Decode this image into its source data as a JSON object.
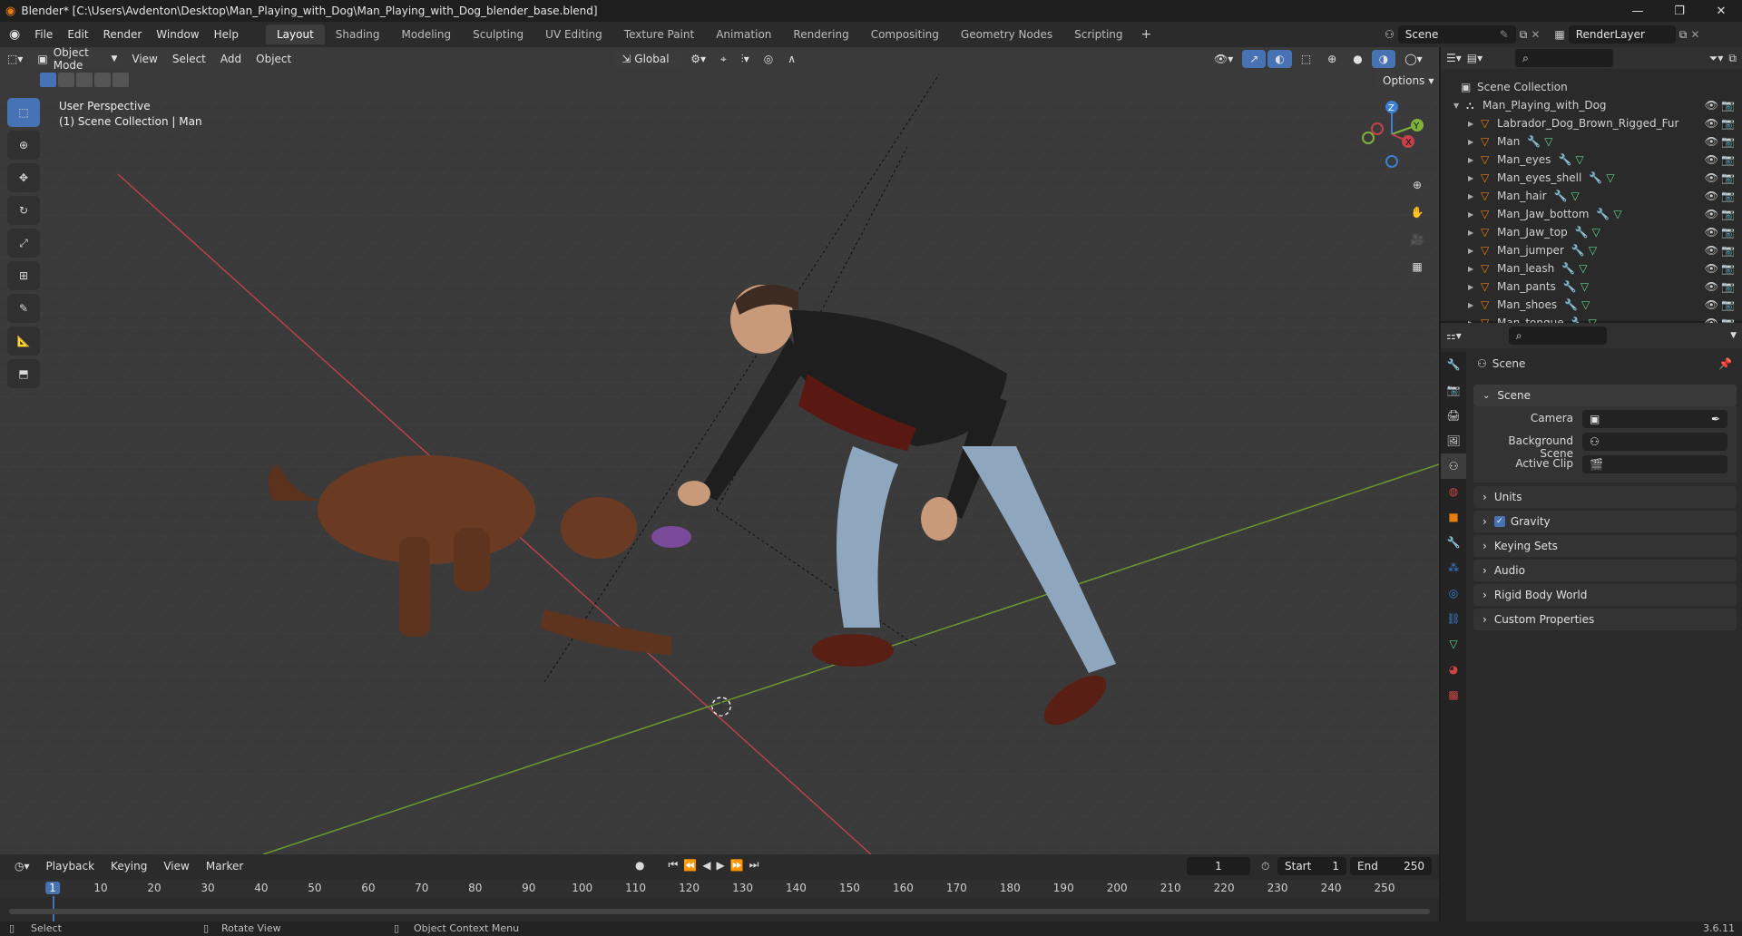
{
  "titlebar": {
    "title": "Blender* [C:\\Users\\Avdenton\\Desktop\\Man_Playing_with_Dog\\Man_Playing_with_Dog_blender_base.blend]"
  },
  "menus": [
    "File",
    "Edit",
    "Render",
    "Window",
    "Help"
  ],
  "workspaces": [
    "Layout",
    "Shading",
    "Modeling",
    "Sculpting",
    "UV Editing",
    "Texture Paint",
    "Animation",
    "Rendering",
    "Compositing",
    "Geometry Nodes",
    "Scripting"
  ],
  "active_workspace": "Layout",
  "scene_field": "Scene",
  "renderlayer_field": "RenderLayer",
  "viewport": {
    "mode": "Object Mode",
    "menus": [
      "View",
      "Select",
      "Add",
      "Object"
    ],
    "transform": "Global",
    "options": "Options",
    "overlay_line1": "User Perspective",
    "overlay_line2": "(1) Scene Collection | Man"
  },
  "outliner": {
    "root": "Scene Collection",
    "collection": "Man_Playing_with_Dog",
    "items": [
      "Labrador_Dog_Brown_Rigged_Fur",
      "Man",
      "Man_eyes",
      "Man_eyes_shell",
      "Man_hair",
      "Man_Jaw_bottom",
      "Man_Jaw_top",
      "Man_jumper",
      "Man_leash",
      "Man_pants",
      "Man_shoes",
      "Man_tongue"
    ]
  },
  "properties": {
    "context": "Scene",
    "section": "Scene",
    "fields": [
      {
        "label": "Camera"
      },
      {
        "label": "Background Scene"
      },
      {
        "label": "Active Clip"
      }
    ],
    "panels": [
      "Units",
      "Gravity",
      "Keying Sets",
      "Audio",
      "Rigid Body World",
      "Custom Properties"
    ]
  },
  "timeline": {
    "menus": [
      "Playback",
      "Keying",
      "View",
      "Marker"
    ],
    "current_frame": "1",
    "start_label": "Start",
    "start": "1",
    "end_label": "End",
    "end": "250",
    "ticks": [
      "1",
      "10",
      "20",
      "30",
      "40",
      "50",
      "60",
      "70",
      "80",
      "90",
      "100",
      "110",
      "120",
      "130",
      "140",
      "150",
      "160",
      "170",
      "180",
      "190",
      "200",
      "210",
      "220",
      "230",
      "240",
      "250"
    ]
  },
  "statusbar": {
    "select": "Select",
    "rotate": "Rotate View",
    "context_menu": "Object Context Menu",
    "version": "3.6.11"
  },
  "colors": {
    "accent": "#4772b3",
    "x_axis": "#c4404b",
    "y_axis": "#7fb03a",
    "z_axis": "#3b7fd6"
  }
}
